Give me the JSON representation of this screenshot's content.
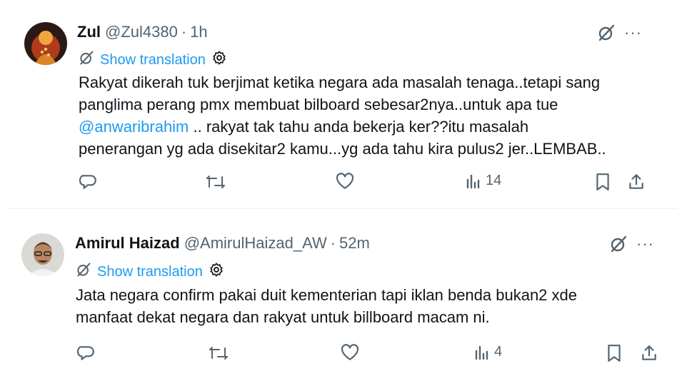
{
  "tweets": [
    {
      "name": "Zul",
      "handle": "@Zul4380",
      "separator": "·",
      "time": "1h",
      "translate_label": "Show translation",
      "lines_before_mention": [
        "Rakyat dikerah tuk berjimat ketika negara ada masalah tenaga..tetapi sang",
        "panglima perang pmx membuat bilboard sebesar2nya..untuk apa tue"
      ],
      "mention": "@anwaribrahim",
      "mention_tail": " .. rakyat tak tahu anda bekerja ker??itu masalah",
      "lines_after_mention": [
        "penerangan yg ada disekitar2 kamu...yg ada tahu kira pulus2 jer..LEMBAB.."
      ],
      "views": "14"
    },
    {
      "name": "Amirul Haizad",
      "handle": "@AmirulHaizad_AW",
      "separator": "·",
      "time": "52m",
      "translate_label": "Show translation",
      "lines": [
        "Jata negara confirm pakai duit kementerian tapi iklan benda bukan2 xde",
        "manfaat dekat negara dan rakyat untuk billboard macam ni."
      ],
      "views": "4"
    }
  ],
  "more_label": "···",
  "colors": {
    "accent": "#1d9bf0",
    "muted": "#536471",
    "text": "#0f1419"
  }
}
